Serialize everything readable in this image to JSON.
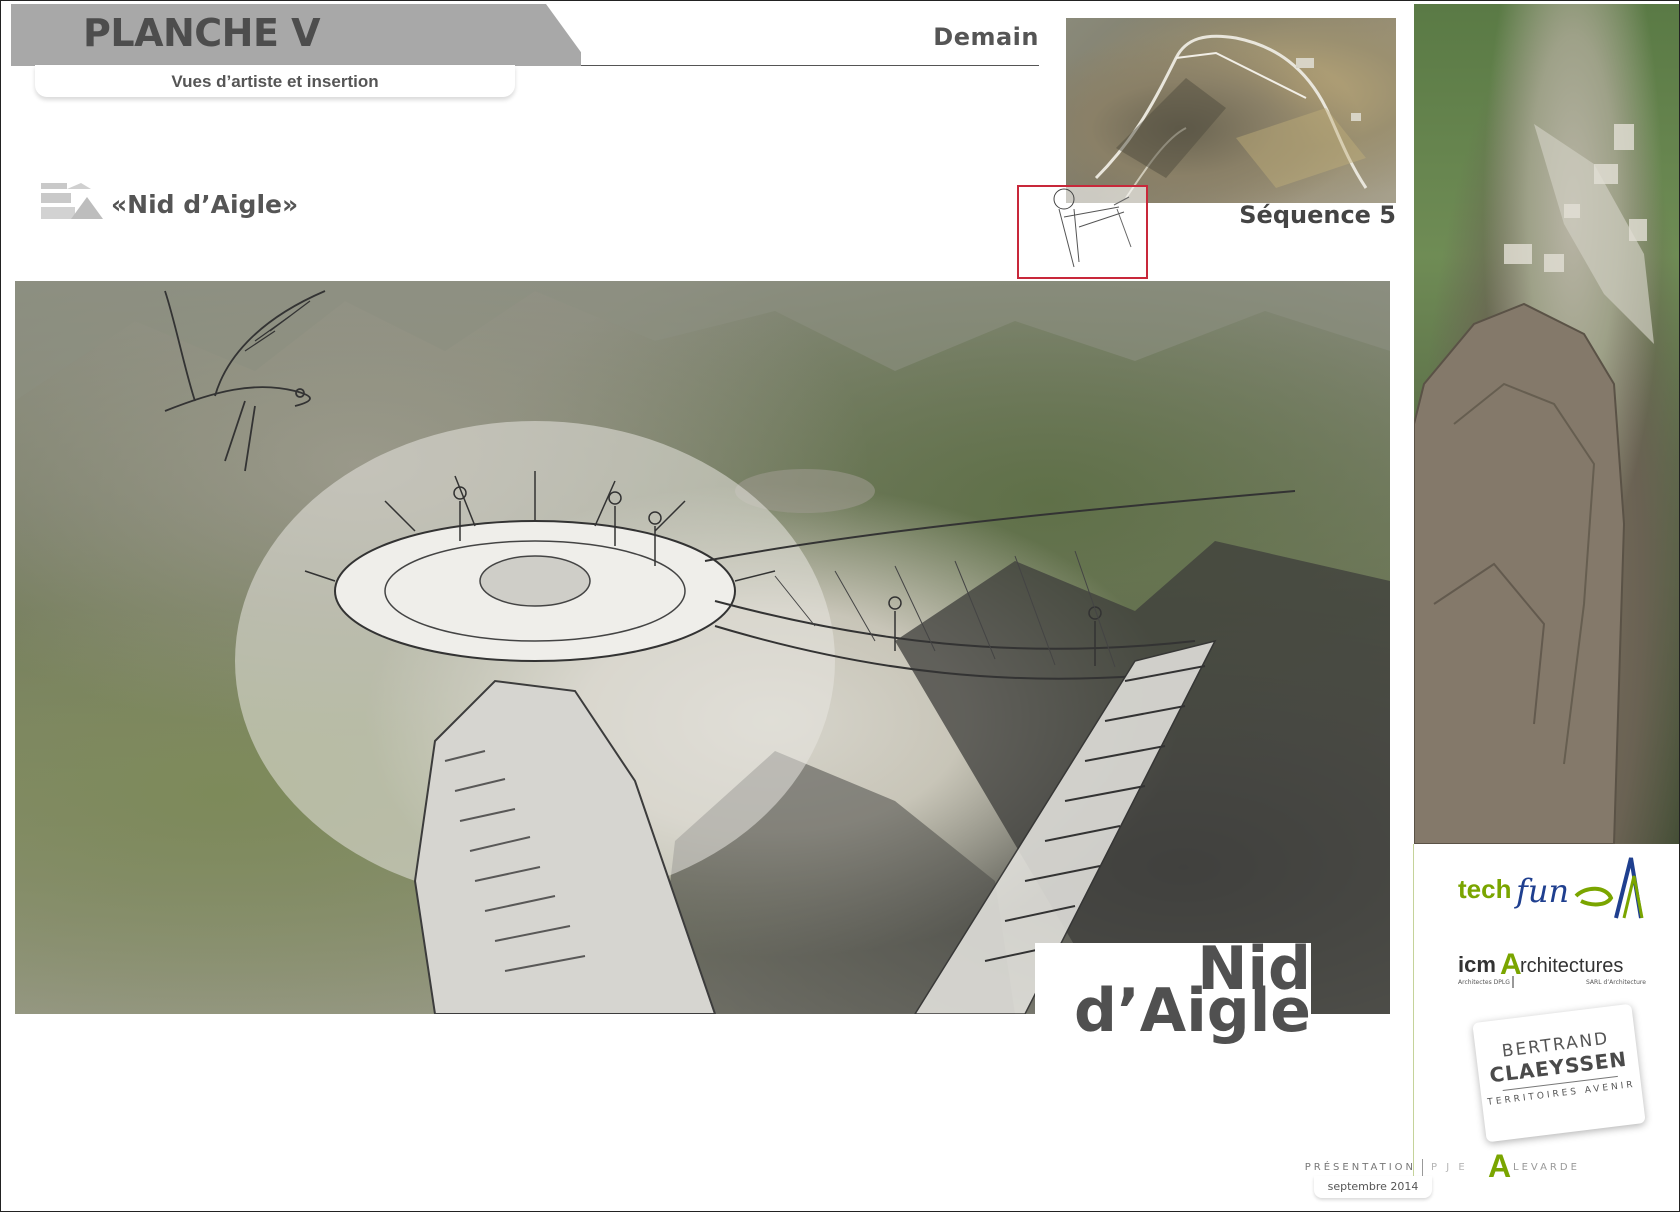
{
  "header": {
    "title": "PLANCHE V",
    "subtitle": "Vues d’artiste et insertion",
    "label_right": "Demain"
  },
  "thumbnail": {
    "sequence_label": "Séquence 5"
  },
  "section": {
    "title": "«Nid d’Aigle»"
  },
  "main_image": {
    "caption_line1": "Nid",
    "caption_line2": "d’Aigle"
  },
  "logos": {
    "techfun": {
      "part1": "tech",
      "part2": "fun"
    },
    "icm": {
      "part1": "icm",
      "part2": "A",
      "part3": "rchitectures",
      "sub1": "Architectes DPLG",
      "sub2": "SARL d’Architecture"
    },
    "bc": {
      "line1": "BERTRAND",
      "line2": "CLAEYSSEN",
      "line3": "TERRITOIRES AVENIR"
    }
  },
  "footer": {
    "text_a": "PRÉSENTATION",
    "text_b": "P  J  E",
    "logo_a": "A",
    "text_c": "LEVARDE",
    "date": "septembre 2014"
  },
  "colors": {
    "header_gray": "#a8a8a8",
    "title_gray": "#4d4d4d",
    "accent_red": "#c8283a",
    "brand_green": "#7aa500",
    "techfun_blue": "#1f3f8f"
  }
}
